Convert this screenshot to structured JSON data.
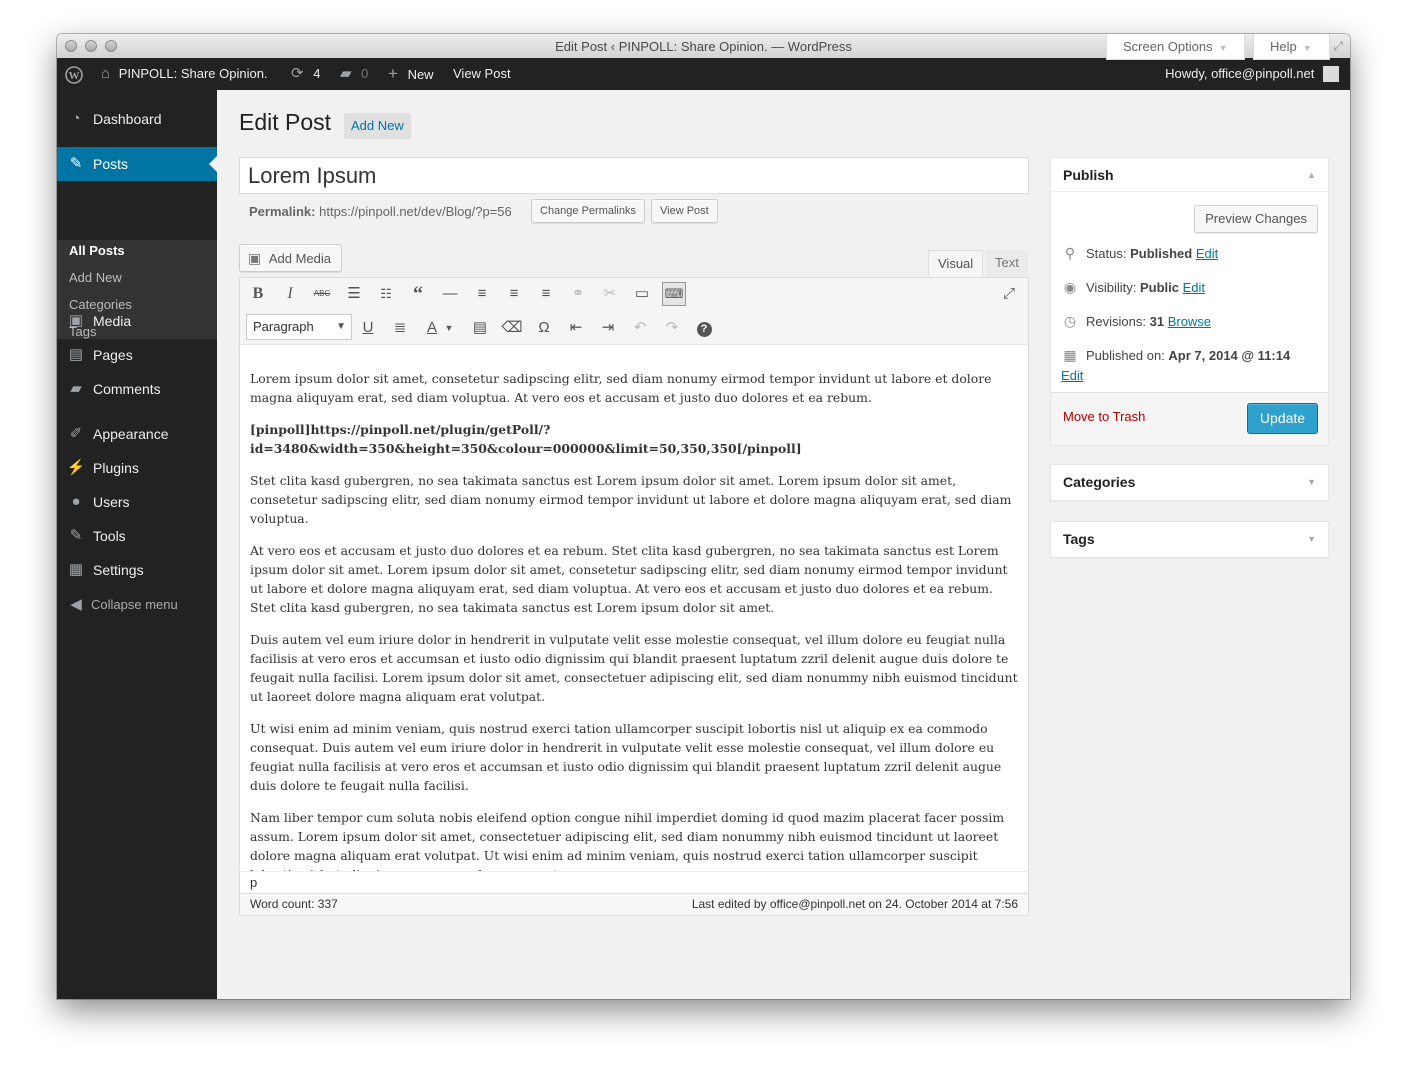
{
  "window": {
    "title": "Edit Post ‹ PINPOLL: Share Opinion. — WordPress"
  },
  "adminbar": {
    "site_name": "PINPOLL: Share Opinion.",
    "updates_count": "4",
    "comments_count": "0",
    "new_label": "New",
    "view_post_label": "View Post",
    "howdy": "Howdy, office@pinpoll.net"
  },
  "sidebar": {
    "dashboard": "Dashboard",
    "posts": "Posts",
    "submenu": [
      "All Posts",
      "Add New",
      "Categories",
      "Tags"
    ],
    "media": "Media",
    "pages": "Pages",
    "comments": "Comments",
    "appearance": "Appearance",
    "plugins": "Plugins",
    "users": "Users",
    "tools": "Tools",
    "settings": "Settings",
    "collapse": "Collapse menu"
  },
  "screen_meta": {
    "screen_options": "Screen Options",
    "help": "Help"
  },
  "header": {
    "title": "Edit Post",
    "add_new": "Add New"
  },
  "post": {
    "title": "Lorem Ipsum",
    "permalink_label": "Permalink:",
    "permalink_url": "https://pinpoll.net/dev/Blog/?p=56",
    "change_permalinks": "Change Permalinks",
    "view_post": "View Post"
  },
  "editor": {
    "add_media": "Add Media",
    "tab_visual": "Visual",
    "tab_text": "Text",
    "format_select": "Paragraph",
    "paragraphs": [
      "Lorem ipsum dolor sit amet, consetetur sadipscing elitr, sed diam nonumy eirmod tempor invidunt ut labore et dolore magna aliquyam erat, sed diam voluptua. At vero eos et accusam et justo duo dolores et ea rebum.",
      "[pinpoll]https://pinpoll.net/plugin/getPoll/?id=3480&width=350&height=350&colour=000000&limit=50,350,350[/pinpoll]",
      "Stet clita kasd gubergren, no sea takimata sanctus est Lorem ipsum dolor sit amet. Lorem ipsum dolor sit amet, consetetur sadipscing elitr, sed diam nonumy eirmod tempor invidunt ut labore et dolore magna aliquyam erat, sed diam voluptua.",
      "At vero eos et accusam et justo duo dolores et ea rebum. Stet clita kasd gubergren, no sea takimata sanctus est Lorem ipsum dolor sit amet. Lorem ipsum dolor sit amet, consetetur sadipscing elitr, sed diam nonumy eirmod tempor invidunt ut labore et dolore magna aliquyam erat, sed diam voluptua. At vero eos et accusam et justo duo dolores et ea rebum. Stet clita kasd gubergren, no sea takimata sanctus est Lorem ipsum dolor sit amet.",
      "Duis autem vel eum iriure dolor in hendrerit in vulputate velit esse molestie consequat, vel illum dolore eu feugiat nulla facilisis at vero eros et accumsan et iusto odio dignissim qui blandit praesent luptatum zzril delenit augue duis dolore te feugait nulla facilisi. Lorem ipsum dolor sit amet, consectetuer adipiscing elit, sed diam nonummy nibh euismod tincidunt ut laoreet dolore magna aliquam erat volutpat.",
      "Ut wisi enim ad minim veniam, quis nostrud exerci tation ullamcorper suscipit lobortis nisl ut aliquip ex ea commodo consequat. Duis autem vel eum iriure dolor in hendrerit in vulputate velit esse molestie consequat, vel illum dolore eu feugiat nulla facilisis at vero eros et accumsan et iusto odio dignissim qui blandit praesent luptatum zzril delenit augue duis dolore te feugait nulla facilisi.",
      "Nam liber tempor cum soluta nobis eleifend option congue nihil imperdiet doming id quod mazim placerat facer possim assum. Lorem ipsum dolor sit amet, consectetuer adipiscing elit, sed diam nonummy nibh euismod tincidunt ut laoreet dolore magna aliquam erat volutpat. Ut wisi enim ad minim veniam, quis nostrud exerci tation ullamcorper suscipit lobortis nisl ut aliquip ex ea commodo consequat."
    ],
    "path": "p",
    "word_count": "Word count: 337",
    "last_edited": "Last edited by office@pinpoll.net on 24. October 2014 at 7:56"
  },
  "publish": {
    "title": "Publish",
    "preview_changes": "Preview Changes",
    "status_label": "Status:",
    "status_value": "Published",
    "visibility_label": "Visibility:",
    "visibility_value": "Public",
    "revisions_label": "Revisions:",
    "revisions_value": "31",
    "browse": "Browse",
    "published_on_label": "Published on:",
    "published_on_value": "Apr 7, 2014 @ 11:14",
    "edit": "Edit",
    "move_to_trash": "Move to Trash",
    "update": "Update"
  },
  "boxes": {
    "categories": "Categories",
    "tags": "Tags"
  },
  "colors": {
    "accent": "#0074a2",
    "primary_button": "#2ea2cc",
    "adminbar": "#222222",
    "trash": "#aa0000"
  }
}
